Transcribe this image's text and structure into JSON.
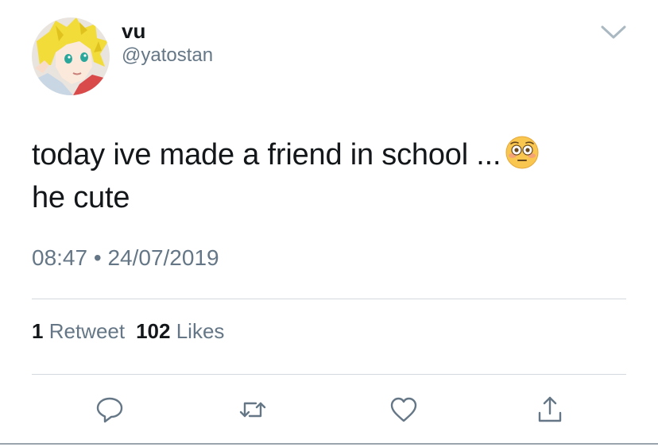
{
  "author": {
    "display_name": "vu",
    "handle": "@yatostan",
    "avatar": "anime-character-avatar"
  },
  "tweet": {
    "text_line1": "today ive made a friend in school ...",
    "emoji": "flushed-face-emoji",
    "text_line2": "he cute",
    "time": "08:47",
    "separator": "•",
    "date": "24/07/2019"
  },
  "stats": {
    "retweets_count": "1",
    "retweets_label": "Retweet",
    "likes_count": "102",
    "likes_label": "Likes"
  },
  "actions": {
    "reply_icon": "reply-icon",
    "retweet_icon": "retweet-icon",
    "like_icon": "heart-icon",
    "share_icon": "share-icon"
  },
  "colors": {
    "text_primary": "#14171a",
    "text_secondary": "#657786",
    "divider": "#d3d9de",
    "icon": "#657786"
  }
}
